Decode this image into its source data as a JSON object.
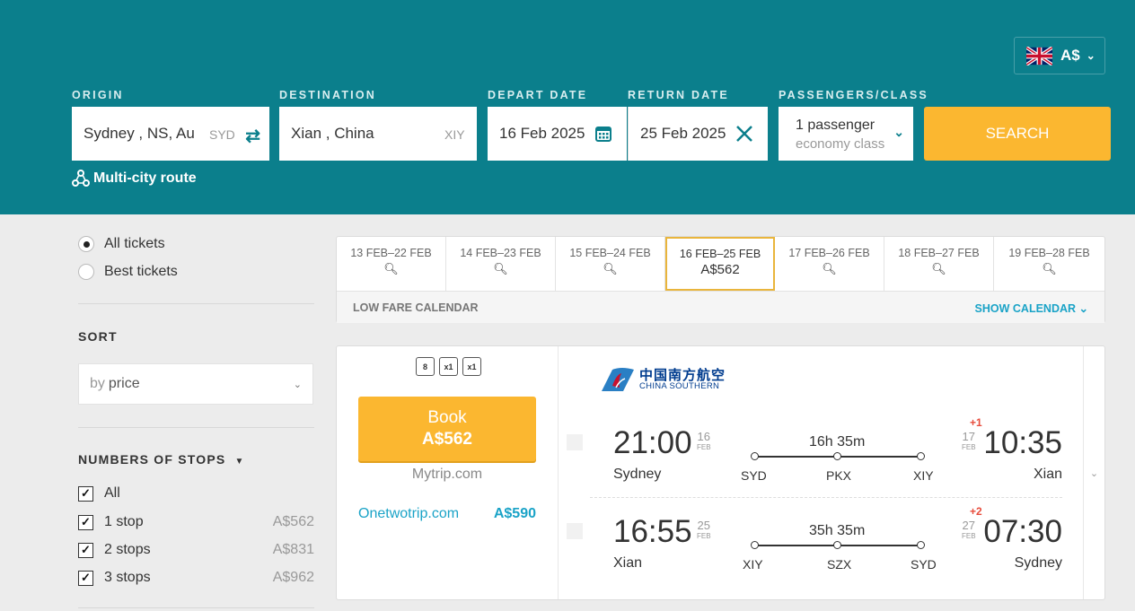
{
  "header": {
    "currency": "A$",
    "multi_city": "Multi-city route",
    "search_label": "SEARCH"
  },
  "form": {
    "origin": {
      "label": "ORIGIN",
      "value": "Sydney , NS, Australia",
      "code": "SYD"
    },
    "destination": {
      "label": "DESTINATION",
      "value": "Xian , China",
      "code": "XIY"
    },
    "depart": {
      "label": "DEPART DATE",
      "value": "16 Feb 2025"
    },
    "return": {
      "label": "RETURN DATE",
      "value": "25 Feb 2025"
    },
    "passengers": {
      "label": "PASSENGERS/CLASS",
      "count": "1 passenger",
      "class": "economy class"
    }
  },
  "sidebar": {
    "ticket_types": [
      {
        "label": "All tickets",
        "selected": true
      },
      {
        "label": "Best tickets",
        "selected": false
      }
    ],
    "sort_heading": "SORT",
    "sort_prefix": "by",
    "sort_value": "price",
    "stops_heading": "NUMBERS OF STOPS",
    "stops": [
      {
        "label": "All",
        "price": "",
        "checked": true
      },
      {
        "label": "1 stop",
        "price": "A$562",
        "checked": true
      },
      {
        "label": "2 stops",
        "price": "A$831",
        "checked": true
      },
      {
        "label": "3 stops",
        "price": "A$962",
        "checked": true
      }
    ]
  },
  "dates": [
    {
      "label": "13 FEB–22 FEB",
      "price": ""
    },
    {
      "label": "14 FEB–23 FEB",
      "price": ""
    },
    {
      "label": "15 FEB–24 FEB",
      "price": ""
    },
    {
      "label": "16 FEB–25 FEB",
      "price": "A$562"
    },
    {
      "label": "17 FEB–26 FEB",
      "price": ""
    },
    {
      "label": "18 FEB–27 FEB",
      "price": ""
    },
    {
      "label": "19 FEB–28 FEB",
      "price": ""
    }
  ],
  "low_fare": {
    "label": "LOW FARE CALENDAR",
    "show": "SHOW CALENDAR"
  },
  "result": {
    "bags": [
      "8",
      "x1",
      "x1"
    ],
    "book_label": "Book",
    "price": "A$562",
    "agency": "Mytrip.com",
    "alt_agency": "Onetwotrip.com",
    "alt_price": "A$590",
    "airline_cn": "中国南方航空",
    "airline_en": "CHINA SOUTHERN",
    "segments": [
      {
        "dep_time": "21:00",
        "dep_day": "16",
        "dep_month": "FEB",
        "dep_city": "Sydney",
        "duration": "16h 35m",
        "codes": [
          "SYD",
          "PKX",
          "XIY"
        ],
        "arr_plus": "+1",
        "arr_day": "17",
        "arr_month": "FEB",
        "arr_time": "10:35",
        "arr_city": "Xian"
      },
      {
        "dep_time": "16:55",
        "dep_day": "25",
        "dep_month": "FEB",
        "dep_city": "Xian",
        "duration": "35h 35m",
        "codes": [
          "XIY",
          "SZX",
          "SYD"
        ],
        "arr_plus": "+2",
        "arr_day": "27",
        "arr_month": "FEB",
        "arr_time": "07:30",
        "arr_city": "Sydney"
      }
    ]
  },
  "colors": {
    "header_bg": "#0b7f8c",
    "accent_yellow": "#fbb730",
    "link_blue": "#1aa3c7"
  }
}
